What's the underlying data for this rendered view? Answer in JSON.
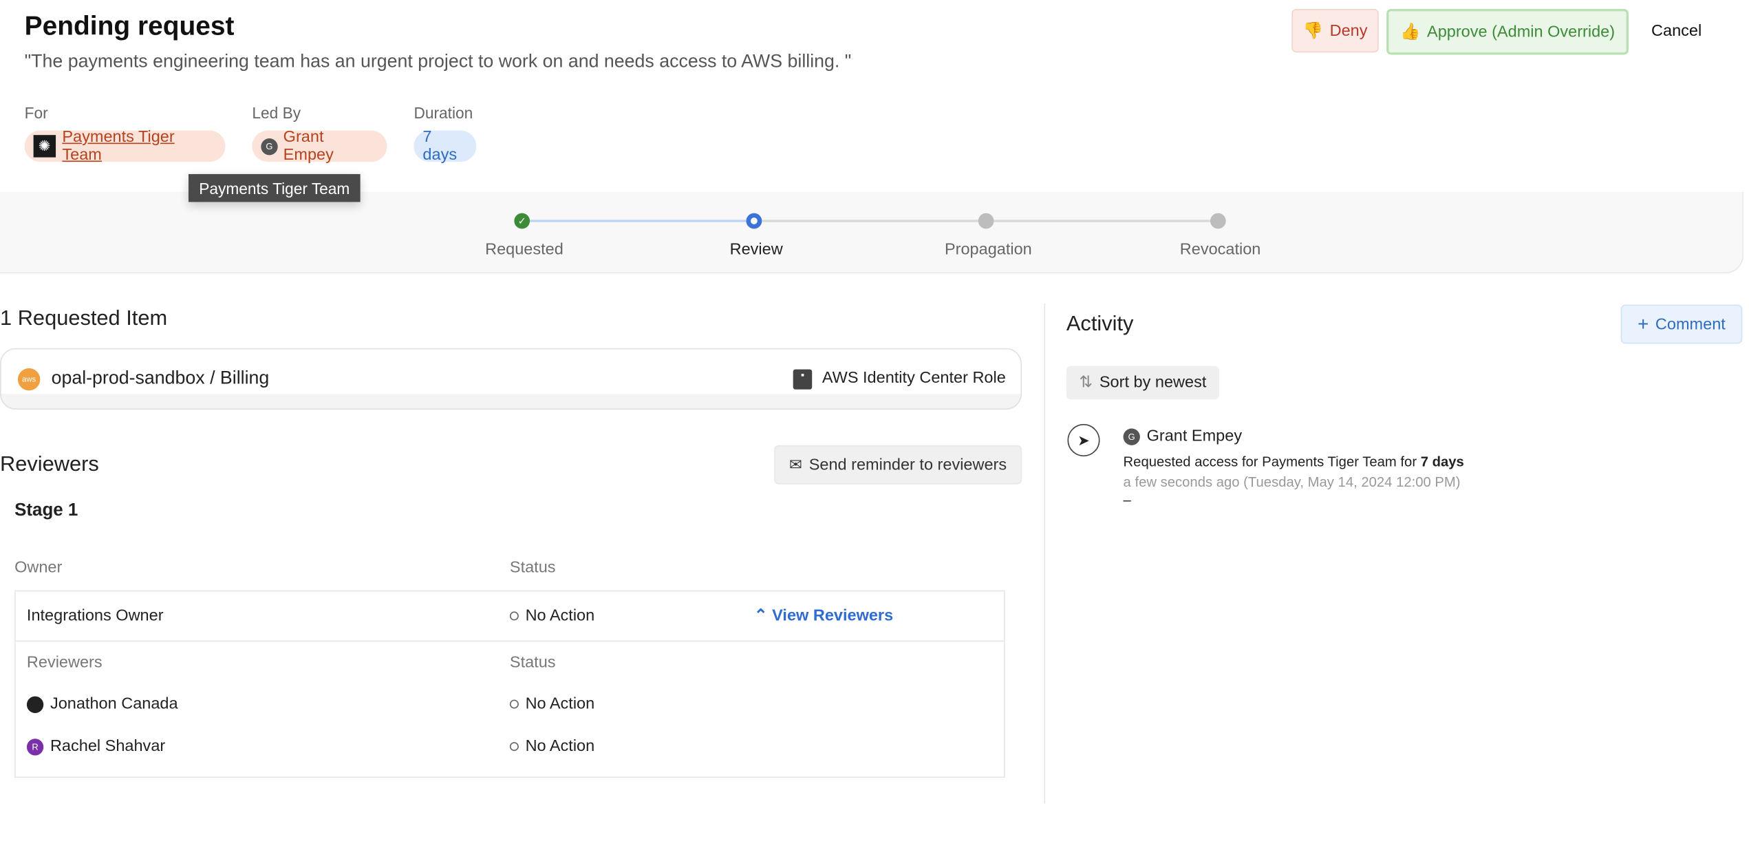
{
  "header": {
    "title": "Pending request",
    "quote": "\"The payments engineering team has an urgent project to work on and needs access to AWS billing. \"",
    "deny": "Deny",
    "approve": "Approve (Admin Override)",
    "cancel": "Cancel"
  },
  "meta": {
    "for_label": "For",
    "for_value": "Payments Tiger Team",
    "led_label": "Led By",
    "led_value": "Grant Empey",
    "led_initial": "G",
    "duration_label": "Duration",
    "duration_value": "7 days",
    "tooltip": "Payments Tiger Team"
  },
  "steps": [
    {
      "label": "Requested",
      "state": "complete"
    },
    {
      "label": "Review",
      "state": "current"
    },
    {
      "label": "Propagation",
      "state": "pending"
    },
    {
      "label": "Revocation",
      "state": "pending"
    }
  ],
  "requested": {
    "heading": "1 Requested Item",
    "item_name": "opal-prod-sandbox / Billing",
    "item_type": "AWS Identity Center Role",
    "icon_text": "aws"
  },
  "reviewers": {
    "heading": "Reviewers",
    "reminder": "Send reminder to reviewers",
    "stage": "Stage 1",
    "owner_header": "Owner",
    "status_header": "Status",
    "owner": {
      "name": "Integrations Owner",
      "status": "No Action",
      "toggle": "View Reviewers"
    },
    "sub_header": "Reviewers",
    "sub_status_header": "Status",
    "list": [
      {
        "name": "Jonathon Canada",
        "status": "No Action",
        "initial": ""
      },
      {
        "name": "Rachel Shahvar",
        "status": "No Action",
        "initial": "R"
      }
    ]
  },
  "activity": {
    "heading": "Activity",
    "comment": "Comment",
    "sort": "Sort by newest",
    "entry": {
      "user": "Grant Empey",
      "initial": "G",
      "text": "Requested access for Payments Tiger Team for ",
      "bold": "7 days",
      "time": "a few seconds ago (Tuesday, May 14, 2024 12:00 PM)",
      "dash": "–"
    }
  },
  "colors": {
    "deny": "#b43a2a",
    "approve": "#3d8b37",
    "link": "#2f6bd0",
    "pill_red": "#fbe3da",
    "pill_blue": "#dceafc"
  }
}
